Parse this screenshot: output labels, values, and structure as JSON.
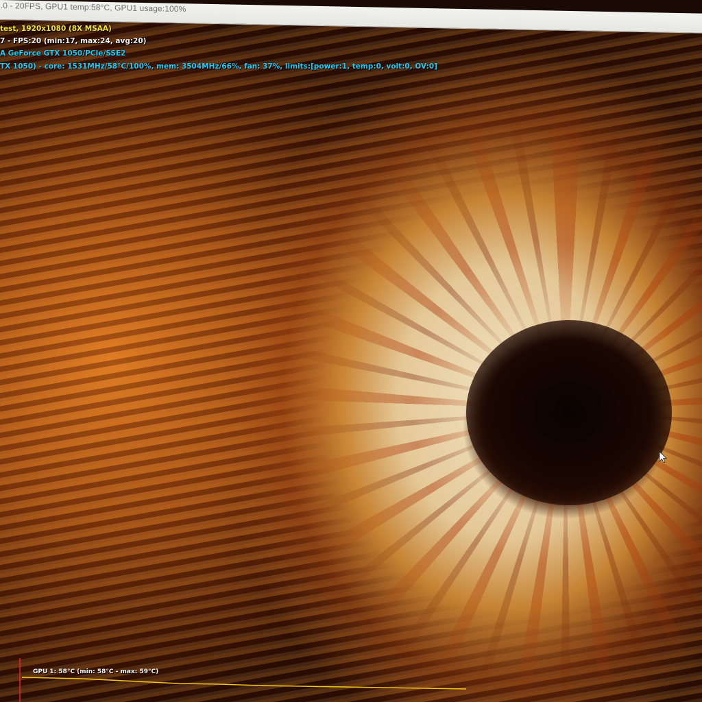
{
  "window": {
    "title": "3.0 - 20FPS, GPU1 temp:58°C, GPU1 usage:100%"
  },
  "osd": {
    "line1": "test, 1920x1080 (8X MSAA)",
    "line2": "7 - FPS:20 (min:17, max:24, avg:20)",
    "line3": "A GeForce GTX 1050/PCIe/SSE2",
    "line4": "TX 1050) - core: 1531MHz/58°C/100%, mem: 3504MHz/66%, fan: 37%, limits:[power:1, temp:0, volt:0, OV:0]"
  },
  "gpu_graph": {
    "label": "GPU 1: 58°C (min: 58°C - max: 59°C)",
    "line_color": "#f0c419",
    "marker_color": "#e8262a"
  },
  "colors": {
    "osd_yellow": "#f4e23a",
    "osd_white": "#f4f4f4",
    "osd_cyan": "#2cc7f0",
    "titlebar_bg": "#efefec"
  },
  "icons": {
    "cursor": "mouse-pointer-icon"
  }
}
